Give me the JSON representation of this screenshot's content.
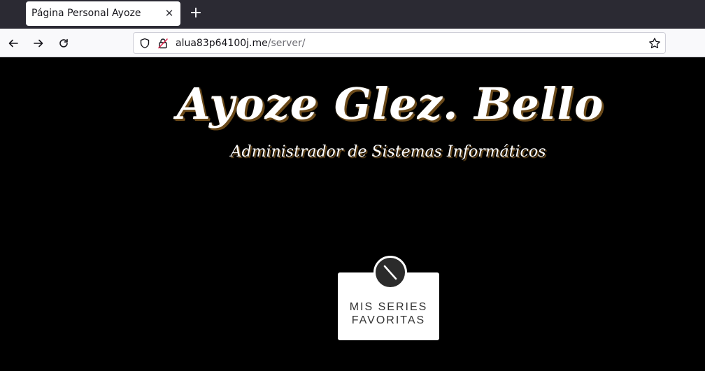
{
  "browser": {
    "tab": {
      "title": "Página Personal Ayoze",
      "close_glyph": "✕"
    },
    "new_tab_glyph": "+",
    "url": {
      "host": "alua83p64100j.me",
      "path": "/server/"
    },
    "icons": [
      "back-arrow-icon",
      "forward-arrow-icon",
      "reload-icon",
      "shield-icon",
      "insecure-lock-icon",
      "bookmark-star-icon"
    ]
  },
  "page": {
    "title": "Ayoze Glez. Bello",
    "subtitle": "Administrador de Sistemas Informáticos",
    "card": {
      "label": "MIS SERIES\nFAVORITAS",
      "icon": "pencil-slash-icon"
    }
  },
  "colors": {
    "tabstrip": "#2b2a33",
    "page_bg": "#000000",
    "card_bg": "#ffffff",
    "card_icon_bg": "#2b2b2b",
    "text_shadow": "#6b4a1a"
  }
}
